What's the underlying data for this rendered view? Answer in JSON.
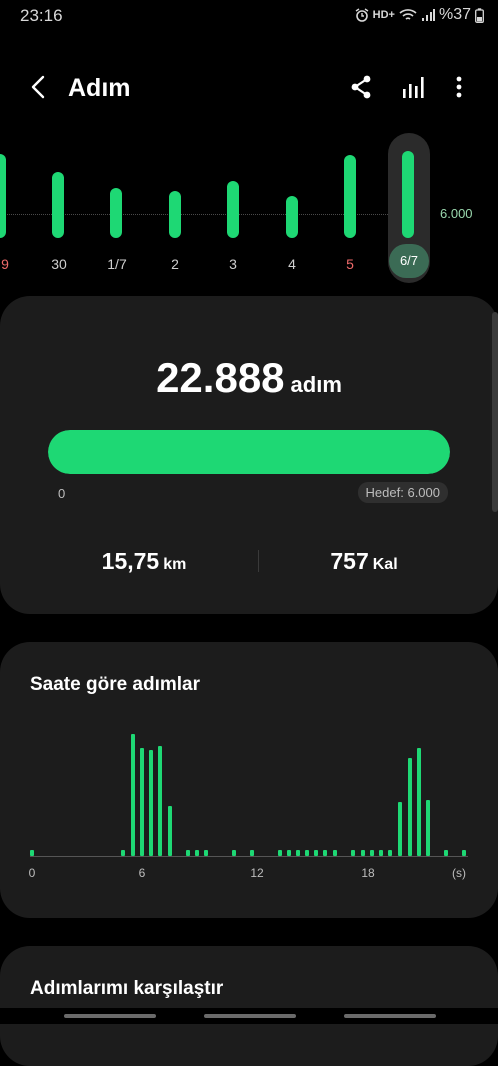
{
  "status": {
    "time": "23:16",
    "network": "HD+",
    "battery": "%37"
  },
  "header": {
    "title": "Adım"
  },
  "week": {
    "goal_label": "6.000",
    "days": [
      {
        "label": "9",
        "red": true
      },
      {
        "label": "30",
        "red": false
      },
      {
        "label": "1/7",
        "red": false
      },
      {
        "label": "2",
        "red": false
      },
      {
        "label": "3",
        "red": false
      },
      {
        "label": "4",
        "red": false
      },
      {
        "label": "5",
        "red": true
      },
      {
        "label": "6/7",
        "red": false,
        "selected": true
      }
    ]
  },
  "summary": {
    "steps": "22.888",
    "steps_unit": "adım",
    "progress_fraction": 1.0,
    "min_label": "0",
    "goal_label": "Hedef: 6.000",
    "distance": "15,75",
    "distance_unit": "km",
    "calories": "757",
    "calories_unit": "Kal"
  },
  "hourly": {
    "title": "Saate göre adımlar",
    "ticks": [
      "0",
      "6",
      "12",
      "18",
      "(s)"
    ]
  },
  "compare": {
    "title": "Adımlarımı karşılaştır"
  },
  "colors": {
    "accent": "#1ed874",
    "card": "#1c1c1c",
    "background": "#000000"
  }
}
